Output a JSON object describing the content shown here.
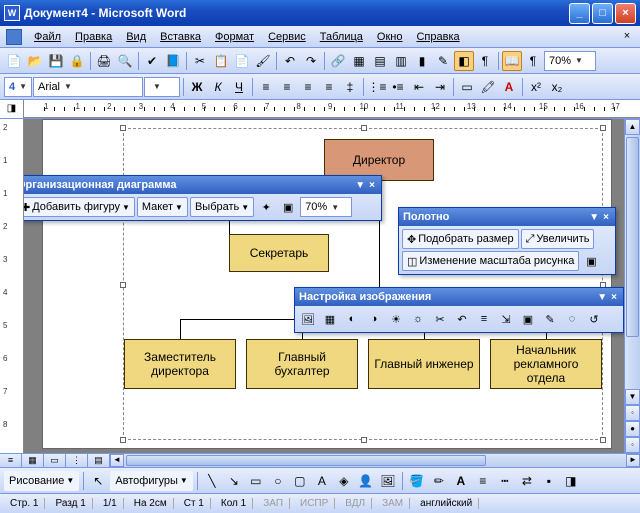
{
  "window": {
    "title": "Документ4 - Microsoft Word",
    "icon": "W"
  },
  "menu": [
    "Файл",
    "Правка",
    "Вид",
    "Вставка",
    "Формат",
    "Сервис",
    "Таблица",
    "Окно",
    "Справка"
  ],
  "toolbar1": {
    "zoom": "70%",
    "icons": [
      "new",
      "open",
      "save",
      "perm",
      "print",
      "preview",
      "spell",
      "research",
      "cut",
      "copy",
      "paste",
      "fmt",
      "undo",
      "redo",
      "link",
      "table",
      "tables",
      "excel",
      "cols",
      "draw",
      "map",
      "para",
      "ruler",
      "help"
    ]
  },
  "toolbar2": {
    "styleNum": "4",
    "font": "Arial",
    "buttons": [
      "Ж",
      "К",
      "Ч"
    ],
    "align": [
      "left",
      "center",
      "right",
      "justify"
    ],
    "more": [
      "linespc",
      "numlist",
      "bullist",
      "outdent",
      "indent",
      "border",
      "hilite",
      "fontcolor",
      "super",
      "sub"
    ]
  },
  "ruler": {
    "nums": [
      "1",
      "",
      "1",
      "2",
      "3",
      "4",
      "5",
      "6",
      "7",
      "8",
      "9",
      "10",
      "11",
      "12",
      "13",
      "14",
      "15",
      "16",
      "17"
    ]
  },
  "rulerV": {
    "nums": [
      "2",
      "1",
      "",
      "1",
      "2",
      "3",
      "4",
      "5",
      "6",
      "7",
      "8"
    ]
  },
  "org": {
    "director": "Директор",
    "secretary": "Секретарь",
    "sub": [
      "Заместитель директора",
      "Главный бухгалтер",
      "Главный инженер",
      "Начальник рекламного отдела"
    ]
  },
  "float_org": {
    "title": "Организационная диаграмма",
    "addShape": "Добавить фигуру",
    "layout": "Макет",
    "select": "Выбрать",
    "zoom": "70%"
  },
  "float_canvas": {
    "title": "Полотно",
    "fit": "Подобрать размер",
    "expand": "Увеличить",
    "scale": "Изменение масштаба рисунка"
  },
  "float_pic": {
    "title": "Настройка изображения",
    "icons": [
      "insert",
      "color",
      "more",
      "less",
      "contrast+",
      "contrast-",
      "crop",
      "rotleft",
      "rotright",
      "line",
      "compress",
      "textwrap",
      "format",
      "transp",
      "reset"
    ]
  },
  "drawbar": {
    "drawing": "Рисование",
    "autoshapes": "Автофигуры",
    "icons": [
      "select",
      "line",
      "arrow",
      "rect",
      "oval",
      "text",
      "wordart",
      "diag",
      "clip",
      "pic",
      "fill",
      "linecolor",
      "fontcolor",
      "linewt",
      "dash",
      "arrows",
      "shadow",
      "3d"
    ]
  },
  "status": {
    "page": "Стр. 1",
    "section": "Разд 1",
    "pp": "1/1",
    "at": "На 2см",
    "line": "Ст 1",
    "col": "Кол 1",
    "rec": "ЗАП",
    "trk": "ИСПР",
    "ext": "ВДЛ",
    "ovr": "ЗАМ",
    "lang": "английский"
  }
}
